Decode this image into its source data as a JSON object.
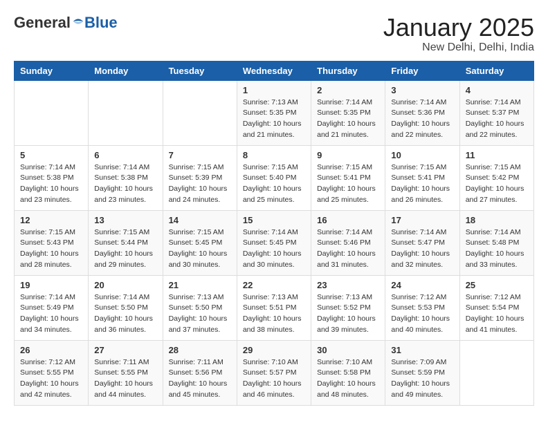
{
  "header": {
    "logo_general": "General",
    "logo_blue": "Blue",
    "title": "January 2025",
    "subtitle": "New Delhi, Delhi, India"
  },
  "weekdays": [
    "Sunday",
    "Monday",
    "Tuesday",
    "Wednesday",
    "Thursday",
    "Friday",
    "Saturday"
  ],
  "weeks": [
    [
      {
        "day": "",
        "sunrise": "",
        "sunset": "",
        "daylight": ""
      },
      {
        "day": "",
        "sunrise": "",
        "sunset": "",
        "daylight": ""
      },
      {
        "day": "",
        "sunrise": "",
        "sunset": "",
        "daylight": ""
      },
      {
        "day": "1",
        "sunrise": "Sunrise: 7:13 AM",
        "sunset": "Sunset: 5:35 PM",
        "daylight": "Daylight: 10 hours and 21 minutes."
      },
      {
        "day": "2",
        "sunrise": "Sunrise: 7:14 AM",
        "sunset": "Sunset: 5:35 PM",
        "daylight": "Daylight: 10 hours and 21 minutes."
      },
      {
        "day": "3",
        "sunrise": "Sunrise: 7:14 AM",
        "sunset": "Sunset: 5:36 PM",
        "daylight": "Daylight: 10 hours and 22 minutes."
      },
      {
        "day": "4",
        "sunrise": "Sunrise: 7:14 AM",
        "sunset": "Sunset: 5:37 PM",
        "daylight": "Daylight: 10 hours and 22 minutes."
      }
    ],
    [
      {
        "day": "5",
        "sunrise": "Sunrise: 7:14 AM",
        "sunset": "Sunset: 5:38 PM",
        "daylight": "Daylight: 10 hours and 23 minutes."
      },
      {
        "day": "6",
        "sunrise": "Sunrise: 7:14 AM",
        "sunset": "Sunset: 5:38 PM",
        "daylight": "Daylight: 10 hours and 23 minutes."
      },
      {
        "day": "7",
        "sunrise": "Sunrise: 7:15 AM",
        "sunset": "Sunset: 5:39 PM",
        "daylight": "Daylight: 10 hours and 24 minutes."
      },
      {
        "day": "8",
        "sunrise": "Sunrise: 7:15 AM",
        "sunset": "Sunset: 5:40 PM",
        "daylight": "Daylight: 10 hours and 25 minutes."
      },
      {
        "day": "9",
        "sunrise": "Sunrise: 7:15 AM",
        "sunset": "Sunset: 5:41 PM",
        "daylight": "Daylight: 10 hours and 25 minutes."
      },
      {
        "day": "10",
        "sunrise": "Sunrise: 7:15 AM",
        "sunset": "Sunset: 5:41 PM",
        "daylight": "Daylight: 10 hours and 26 minutes."
      },
      {
        "day": "11",
        "sunrise": "Sunrise: 7:15 AM",
        "sunset": "Sunset: 5:42 PM",
        "daylight": "Daylight: 10 hours and 27 minutes."
      }
    ],
    [
      {
        "day": "12",
        "sunrise": "Sunrise: 7:15 AM",
        "sunset": "Sunset: 5:43 PM",
        "daylight": "Daylight: 10 hours and 28 minutes."
      },
      {
        "day": "13",
        "sunrise": "Sunrise: 7:15 AM",
        "sunset": "Sunset: 5:44 PM",
        "daylight": "Daylight: 10 hours and 29 minutes."
      },
      {
        "day": "14",
        "sunrise": "Sunrise: 7:15 AM",
        "sunset": "Sunset: 5:45 PM",
        "daylight": "Daylight: 10 hours and 30 minutes."
      },
      {
        "day": "15",
        "sunrise": "Sunrise: 7:14 AM",
        "sunset": "Sunset: 5:45 PM",
        "daylight": "Daylight: 10 hours and 30 minutes."
      },
      {
        "day": "16",
        "sunrise": "Sunrise: 7:14 AM",
        "sunset": "Sunset: 5:46 PM",
        "daylight": "Daylight: 10 hours and 31 minutes."
      },
      {
        "day": "17",
        "sunrise": "Sunrise: 7:14 AM",
        "sunset": "Sunset: 5:47 PM",
        "daylight": "Daylight: 10 hours and 32 minutes."
      },
      {
        "day": "18",
        "sunrise": "Sunrise: 7:14 AM",
        "sunset": "Sunset: 5:48 PM",
        "daylight": "Daylight: 10 hours and 33 minutes."
      }
    ],
    [
      {
        "day": "19",
        "sunrise": "Sunrise: 7:14 AM",
        "sunset": "Sunset: 5:49 PM",
        "daylight": "Daylight: 10 hours and 34 minutes."
      },
      {
        "day": "20",
        "sunrise": "Sunrise: 7:14 AM",
        "sunset": "Sunset: 5:50 PM",
        "daylight": "Daylight: 10 hours and 36 minutes."
      },
      {
        "day": "21",
        "sunrise": "Sunrise: 7:13 AM",
        "sunset": "Sunset: 5:50 PM",
        "daylight": "Daylight: 10 hours and 37 minutes."
      },
      {
        "day": "22",
        "sunrise": "Sunrise: 7:13 AM",
        "sunset": "Sunset: 5:51 PM",
        "daylight": "Daylight: 10 hours and 38 minutes."
      },
      {
        "day": "23",
        "sunrise": "Sunrise: 7:13 AM",
        "sunset": "Sunset: 5:52 PM",
        "daylight": "Daylight: 10 hours and 39 minutes."
      },
      {
        "day": "24",
        "sunrise": "Sunrise: 7:12 AM",
        "sunset": "Sunset: 5:53 PM",
        "daylight": "Daylight: 10 hours and 40 minutes."
      },
      {
        "day": "25",
        "sunrise": "Sunrise: 7:12 AM",
        "sunset": "Sunset: 5:54 PM",
        "daylight": "Daylight: 10 hours and 41 minutes."
      }
    ],
    [
      {
        "day": "26",
        "sunrise": "Sunrise: 7:12 AM",
        "sunset": "Sunset: 5:55 PM",
        "daylight": "Daylight: 10 hours and 42 minutes."
      },
      {
        "day": "27",
        "sunrise": "Sunrise: 7:11 AM",
        "sunset": "Sunset: 5:55 PM",
        "daylight": "Daylight: 10 hours and 44 minutes."
      },
      {
        "day": "28",
        "sunrise": "Sunrise: 7:11 AM",
        "sunset": "Sunset: 5:56 PM",
        "daylight": "Daylight: 10 hours and 45 minutes."
      },
      {
        "day": "29",
        "sunrise": "Sunrise: 7:10 AM",
        "sunset": "Sunset: 5:57 PM",
        "daylight": "Daylight: 10 hours and 46 minutes."
      },
      {
        "day": "30",
        "sunrise": "Sunrise: 7:10 AM",
        "sunset": "Sunset: 5:58 PM",
        "daylight": "Daylight: 10 hours and 48 minutes."
      },
      {
        "day": "31",
        "sunrise": "Sunrise: 7:09 AM",
        "sunset": "Sunset: 5:59 PM",
        "daylight": "Daylight: 10 hours and 49 minutes."
      },
      {
        "day": "",
        "sunrise": "",
        "sunset": "",
        "daylight": ""
      }
    ]
  ]
}
